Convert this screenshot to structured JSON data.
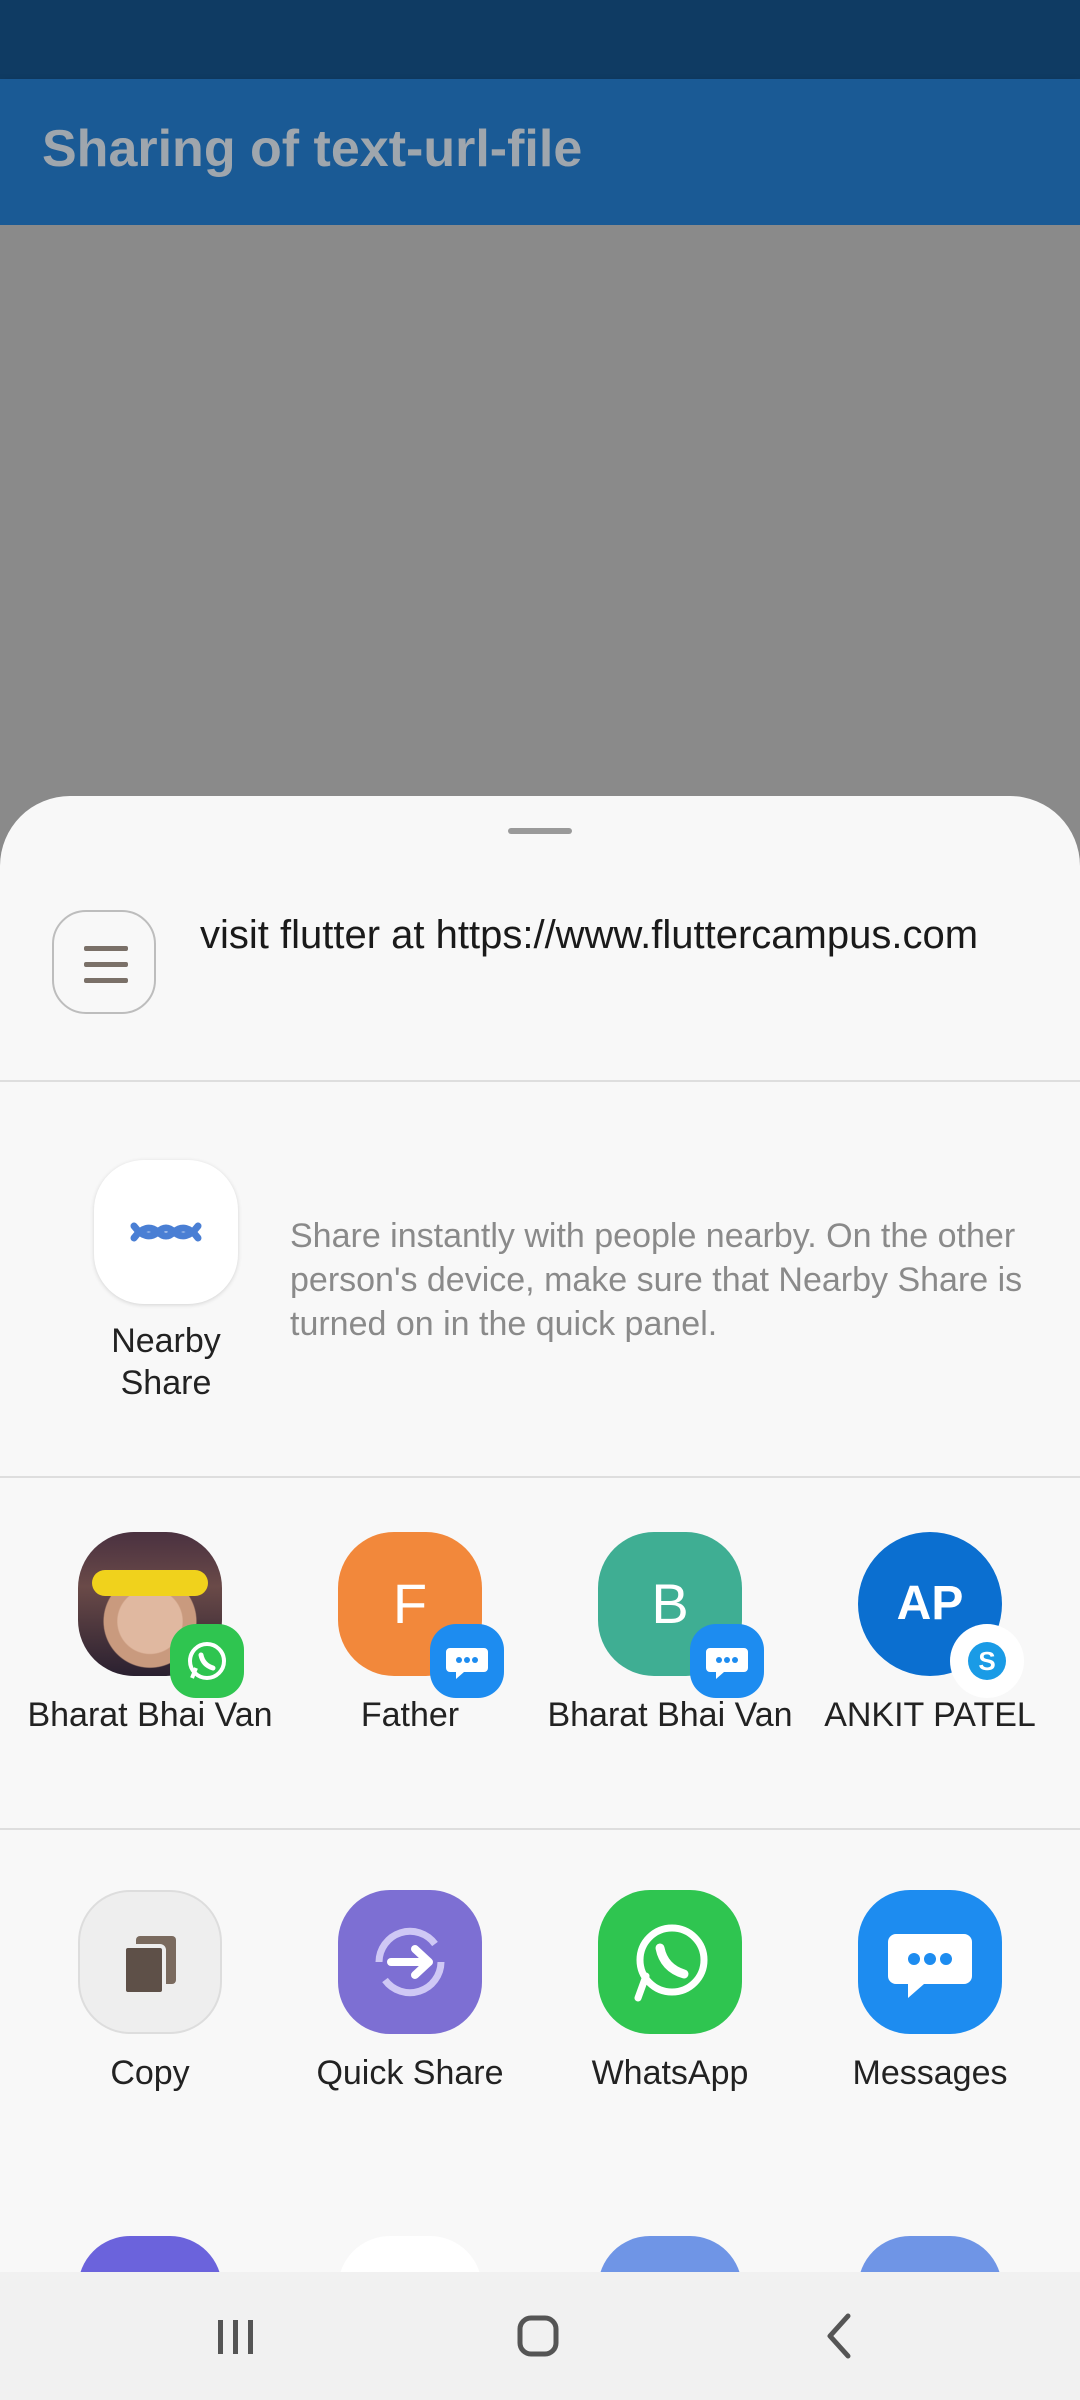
{
  "app_bar": {
    "title": "Sharing of text-url-file"
  },
  "share_sheet": {
    "preview": {
      "icon": "document-lines-icon",
      "text": "visit flutter at https://www.fluttercampus.com"
    },
    "nearby_share": {
      "label": "Nearby Share",
      "description": "Share instantly with people nearby. On the other person's device, make sure that Nearby Share is turned on in the quick panel.",
      "icon": "nearby-share-icon",
      "color": "#4a7fd4"
    },
    "direct_share": [
      {
        "name": "Bharat Bhai Van",
        "avatar": "photo",
        "badge": "whatsapp-badge-icon"
      },
      {
        "name": "Father",
        "avatar_letter": "F",
        "avatar_color": "#f2883b",
        "badge": "messages-badge-icon"
      },
      {
        "name": "Bharat Bhai Van",
        "avatar_letter": "B",
        "avatar_color": "#3fae93",
        "badge": "messages-badge-icon"
      },
      {
        "name": "ANKIT PATEL",
        "avatar_letter": "AP",
        "avatar_color": "#0b6fd0",
        "badge": "skype-badge-icon"
      }
    ],
    "apps": [
      {
        "label": "Copy",
        "icon": "copy-icon",
        "color": "#eeeeee"
      },
      {
        "label": "Quick Share",
        "icon": "quick-share-icon",
        "color": "#7d6fd3"
      },
      {
        "label": "WhatsApp",
        "icon": "whatsapp-icon",
        "color": "#2fc550"
      },
      {
        "label": "Messages",
        "icon": "messages-icon",
        "color": "#1d8cf0"
      }
    ]
  },
  "nav": {
    "recents": "recents-icon",
    "home": "home-icon",
    "back": "back-icon"
  }
}
